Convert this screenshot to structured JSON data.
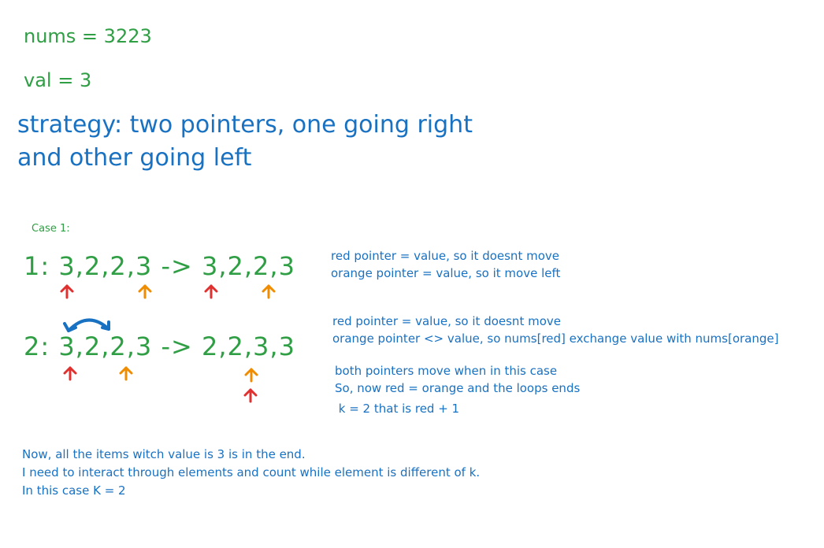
{
  "header": {
    "nums_line": "nums = 3223",
    "val_line": "val = 3"
  },
  "strategy": {
    "line1": "strategy: two pointers, one going right",
    "line2": "and other going left"
  },
  "case": {
    "label": "Case 1:",
    "step1": {
      "expr": "1: 3,2,2,3 -> 3,2,2,3",
      "notes": [
        "red pointer = value, so it doesnt move",
        "orange pointer = value, so it move left"
      ]
    },
    "step2": {
      "expr": "2: 3,2,2,3 -> 2,2,3,3",
      "notes": [
        "red pointer = value, so it doesnt move",
        "orange pointer <> value, so nums[red] exchange value with nums[orange]"
      ],
      "notes2": [
        "both pointers move when in this case",
        "So, now red = orange and the loops ends",
        " k = 2 that is red + 1"
      ]
    }
  },
  "conclusion": [
    "Now, all the items witch value is 3 is in the end.",
    "I need to interact through elements and count while element is different of k.",
    "In this case K = 2"
  ],
  "colors": {
    "green": "#2f9e44",
    "blue": "#1971c2",
    "red_pointer": "#e03131",
    "orange_pointer": "#f08c00",
    "swap_arrow": "#1971c2"
  },
  "icons": {
    "red_pointer": "up-arrow-icon",
    "orange_pointer": "up-arrow-icon",
    "swap": "curved-double-arrow-icon"
  }
}
